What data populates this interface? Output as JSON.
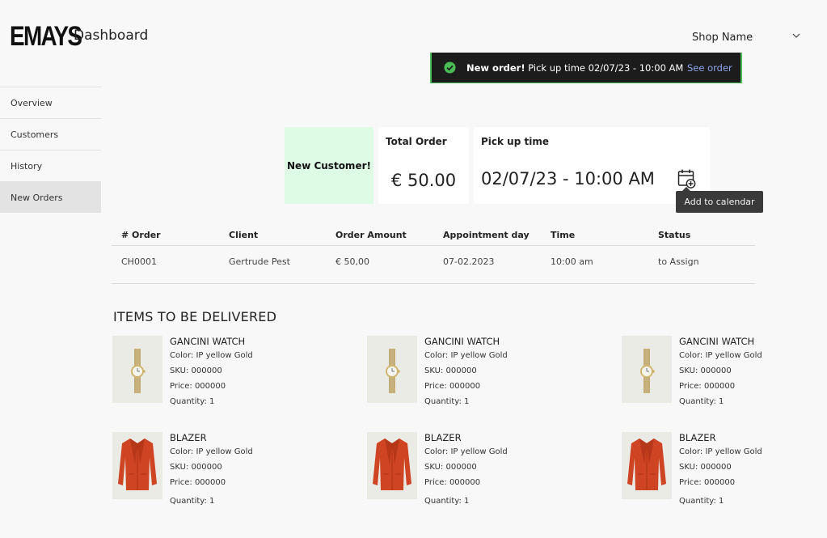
{
  "header": {
    "logo": "EMAYS",
    "title": "Dashboard",
    "shop_select": "Shop Name"
  },
  "toast": {
    "bold": "New order!",
    "text": " Pick up time 02/07/23 - 10:00 AM",
    "link": "See order",
    "accent": "#4bbd57"
  },
  "sidebar": {
    "items": [
      {
        "label": "Overview"
      },
      {
        "label": "Customers"
      },
      {
        "label": "History"
      },
      {
        "label": "New Orders"
      }
    ]
  },
  "cards": {
    "new_customer": "New Customer!",
    "total_label": "Total Order",
    "total_value": "€ 50.00",
    "pickup_label": "Pick up time",
    "pickup_value": "02/07/23 - 10:00 AM",
    "calendar_tooltip": "Add to calendar"
  },
  "table": {
    "headers": [
      "# Order",
      "Client",
      "Order Amount",
      "Appointment day",
      "Time",
      "Status"
    ],
    "rows": [
      [
        "CH0001",
        "Gertrude Pest",
        "€ 50,00",
        "07-02.2023",
        "10:00 am",
        "to Assign"
      ]
    ]
  },
  "items_section": {
    "title": "ITEMS TO BE DELIVERED",
    "items": [
      {
        "name": "GANCINI WATCH",
        "color": "Color: IP yellow Gold",
        "sku": "SKU: 000000",
        "price": "Price: 000000",
        "quantity": "Quantity: 1",
        "icon": "watch"
      },
      {
        "name": "GANCINI WATCH",
        "color": "Color: IP yellow Gold",
        "sku": "SKU: 000000",
        "price": "Price: 000000",
        "quantity": "Quantity: 1",
        "icon": "watch"
      },
      {
        "name": "GANCINI WATCH",
        "color": "Color: IP yellow Gold",
        "sku": "SKU: 000000",
        "price": "Price: 000000",
        "quantity": "Quantity: 1",
        "icon": "watch"
      },
      {
        "name": "BLAZER",
        "color": "Color: IP yellow Gold",
        "sku": "SKU: 000000",
        "price": "Price: 000000",
        "quantity": "Quantity: 1",
        "icon": "blazer"
      },
      {
        "name": "BLAZER",
        "color": "Color: IP yellow Gold",
        "sku": "SKU: 000000",
        "price": "Price: 000000",
        "quantity": "Quantity: 1",
        "icon": "blazer"
      },
      {
        "name": "BLAZER",
        "color": "Color: IP yellow Gold",
        "sku": "SKU: 000000",
        "price": "Price: 000000",
        "quantity": "Quantity: 1",
        "icon": "blazer"
      }
    ]
  }
}
